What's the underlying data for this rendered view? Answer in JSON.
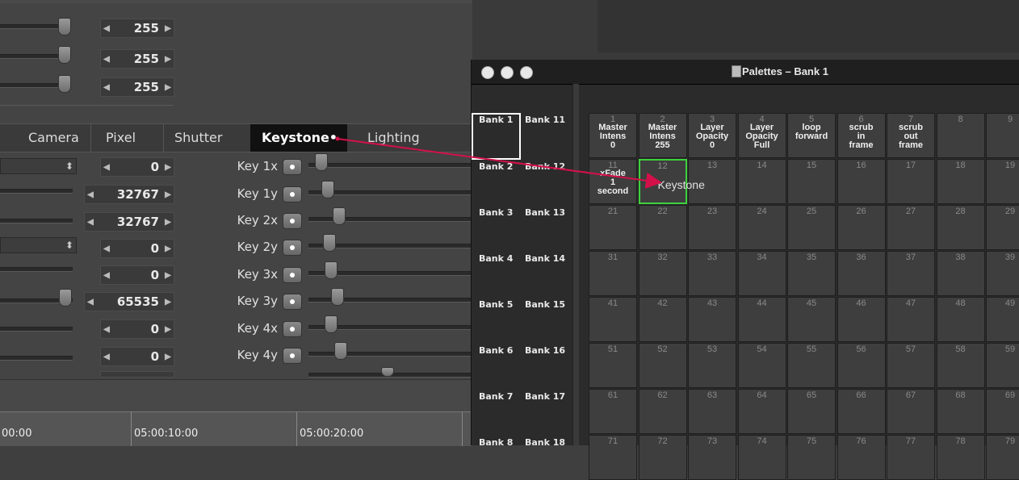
{
  "sliders_top": {
    "values": [
      "255",
      "255",
      "255"
    ]
  },
  "tabs": [
    "Camera",
    "Pixel",
    "Shutter",
    "Keystone•",
    "Lighting"
  ],
  "steppers": [
    "0",
    "32767",
    "32767",
    "0",
    "0",
    "65535",
    "0",
    "0"
  ],
  "keystone_controls": [
    "Key 1x",
    "Key 1y",
    "Key 2x",
    "Key 2y",
    "Key 3x",
    "Key 3y",
    "Key 4x",
    "Key 4y"
  ],
  "dropdown_glyph": "⬍",
  "timeline": {
    "labels": [
      "00:00",
      "05:00:10:00",
      "05:00:20:00"
    ]
  },
  "palette_window": {
    "title": "Palettes – Bank 1",
    "banks_left": [
      "Bank 1",
      "Bank 2",
      "Bank 3",
      "Bank 4",
      "Bank 5",
      "Bank 6",
      "Bank 7",
      "Bank 8"
    ],
    "banks_right": [
      "Bank 11",
      "Bank 12",
      "Bank 13",
      "Bank 14",
      "Bank 15",
      "Bank 16",
      "Bank 17",
      "Bank 18"
    ],
    "rows": [
      [
        {
          "num": "1",
          "label": "Master\nIntens\n0"
        },
        {
          "num": "2",
          "label": "Master\nIntens\n255"
        },
        {
          "num": "3",
          "label": "Layer\nOpacity\n0"
        },
        {
          "num": "4",
          "label": "Layer\nOpacity\nFull"
        },
        {
          "num": "5",
          "label": "loop\nforward"
        },
        {
          "num": "6",
          "label": "scrub\nin\nframe"
        },
        {
          "num": "7",
          "label": "scrub\nout\nframe"
        },
        {
          "num": "8",
          "label": ""
        },
        {
          "num": "9",
          "label": ""
        }
      ],
      [
        {
          "num": "11",
          "label": "xFade\n1\nsecond"
        },
        {
          "num": "12",
          "label": ""
        },
        {
          "num": "13",
          "label": ""
        },
        {
          "num": "14",
          "label": ""
        },
        {
          "num": "15",
          "label": ""
        },
        {
          "num": "16",
          "label": ""
        },
        {
          "num": "17",
          "label": ""
        },
        {
          "num": "18",
          "label": ""
        },
        {
          "num": "19",
          "label": ""
        }
      ],
      [
        {
          "num": "21",
          "label": ""
        },
        {
          "num": "22",
          "label": ""
        },
        {
          "num": "23",
          "label": ""
        },
        {
          "num": "24",
          "label": ""
        },
        {
          "num": "25",
          "label": ""
        },
        {
          "num": "26",
          "label": ""
        },
        {
          "num": "27",
          "label": ""
        },
        {
          "num": "28",
          "label": ""
        },
        {
          "num": "29",
          "label": ""
        }
      ],
      [
        {
          "num": "31",
          "label": ""
        },
        {
          "num": "32",
          "label": ""
        },
        {
          "num": "33",
          "label": ""
        },
        {
          "num": "34",
          "label": ""
        },
        {
          "num": "35",
          "label": ""
        },
        {
          "num": "36",
          "label": ""
        },
        {
          "num": "37",
          "label": ""
        },
        {
          "num": "38",
          "label": ""
        },
        {
          "num": "39",
          "label": ""
        }
      ],
      [
        {
          "num": "41",
          "label": ""
        },
        {
          "num": "42",
          "label": ""
        },
        {
          "num": "43",
          "label": ""
        },
        {
          "num": "44",
          "label": ""
        },
        {
          "num": "45",
          "label": ""
        },
        {
          "num": "46",
          "label": ""
        },
        {
          "num": "47",
          "label": ""
        },
        {
          "num": "48",
          "label": ""
        },
        {
          "num": "49",
          "label": ""
        }
      ],
      [
        {
          "num": "51",
          "label": ""
        },
        {
          "num": "52",
          "label": ""
        },
        {
          "num": "53",
          "label": ""
        },
        {
          "num": "54",
          "label": ""
        },
        {
          "num": "55",
          "label": ""
        },
        {
          "num": "56",
          "label": ""
        },
        {
          "num": "57",
          "label": ""
        },
        {
          "num": "58",
          "label": ""
        },
        {
          "num": "59",
          "label": ""
        }
      ],
      [
        {
          "num": "61",
          "label": ""
        },
        {
          "num": "62",
          "label": ""
        },
        {
          "num": "63",
          "label": ""
        },
        {
          "num": "64",
          "label": ""
        },
        {
          "num": "65",
          "label": ""
        },
        {
          "num": "66",
          "label": ""
        },
        {
          "num": "67",
          "label": ""
        },
        {
          "num": "68",
          "label": ""
        },
        {
          "num": "69",
          "label": ""
        }
      ],
      [
        {
          "num": "71",
          "label": ""
        },
        {
          "num": "72",
          "label": ""
        },
        {
          "num": "73",
          "label": ""
        },
        {
          "num": "74",
          "label": ""
        },
        {
          "num": "75",
          "label": ""
        },
        {
          "num": "76",
          "label": ""
        },
        {
          "num": "77",
          "label": ""
        },
        {
          "num": "78",
          "label": ""
        },
        {
          "num": "79",
          "label": ""
        }
      ]
    ],
    "drop_label": "Keystone"
  },
  "colors": {
    "arrow": "#d4104a",
    "selected_cell": "#3ed13e",
    "selected_tab": "#111111"
  }
}
